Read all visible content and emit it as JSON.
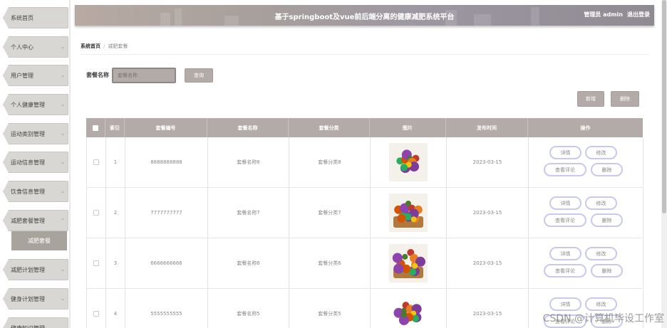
{
  "sidebar": {
    "items": [
      {
        "label": "系统首页",
        "chevron": false
      },
      {
        "label": "个人中心",
        "chevron": true
      },
      {
        "label": "用户管理",
        "chevron": true
      },
      {
        "label": "个人健康管理",
        "chevron": true
      },
      {
        "label": "运动类别管理",
        "chevron": true
      },
      {
        "label": "运动信息管理",
        "chevron": true
      },
      {
        "label": "饮食信息管理",
        "chevron": true
      },
      {
        "label": "减肥套餐管理",
        "chevron": true,
        "expanded": true
      },
      {
        "label": "减肥计划管理",
        "chevron": true
      },
      {
        "label": "健身计划管理",
        "chevron": true
      },
      {
        "label": "健康知识管理",
        "chevron": true
      }
    ],
    "sub_item": "减肥套餐",
    "chevron_down": "⌄",
    "chevron_up": "⌃"
  },
  "header": {
    "title": "基于springboot及vue前后端分离的健康减肥系统平台",
    "user": "管理员 admin",
    "logout": "退出登录"
  },
  "breadcrumb": {
    "home": "系统首页",
    "sep": "/",
    "current": "减肥套餐"
  },
  "search": {
    "label": "套餐名称",
    "placeholder": "套餐名称",
    "button": "查询"
  },
  "actions": {
    "add": "新增",
    "delete": "删除"
  },
  "table": {
    "headers": [
      "索引",
      "套餐编号",
      "套餐名称",
      "套餐分类",
      "图片",
      "发布时间",
      "操作"
    ],
    "rows": [
      {
        "index": "1",
        "code": "8888888888",
        "name": "套餐名称8",
        "category": "套餐分类8",
        "time": "2023-03-15"
      },
      {
        "index": "2",
        "code": "7777777777",
        "name": "套餐名称7",
        "category": "套餐分类7",
        "time": "2023-03-15"
      },
      {
        "index": "3",
        "code": "6666666666",
        "name": "套餐名称6",
        "category": "套餐分类6",
        "time": "2023-03-15"
      },
      {
        "index": "4",
        "code": "5555555555",
        "name": "套餐名称5",
        "category": "套餐分类5",
        "time": "2023-03-15"
      }
    ],
    "ops": {
      "detail": "详情",
      "edit": "修改",
      "comments": "查看评论",
      "delete": "删除"
    }
  },
  "watermark": "CSDN @计算机毕设工作室",
  "colors": {
    "accent": "#b2aba7",
    "op_border": "#c9c8ee"
  }
}
